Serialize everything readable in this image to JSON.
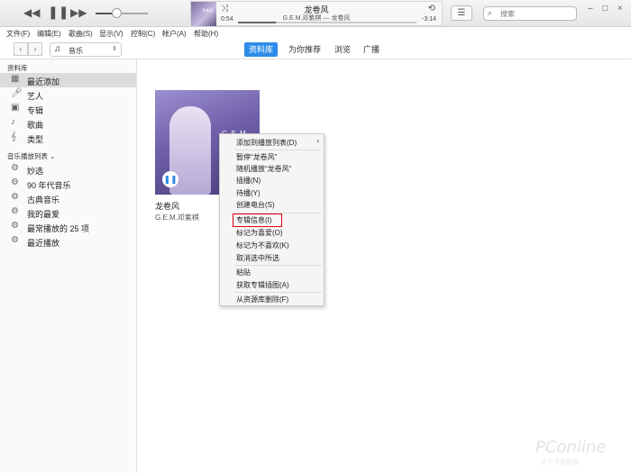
{
  "player": {
    "song_title": "龙卷风",
    "song_subtitle": "G.E.M.邓紫棋 — 龙卷风",
    "elapsed": "0:54",
    "remaining": "-3:14",
    "progress": 0.21,
    "volume": 0.4,
    "artwork_text": "龙卷风",
    "icons": [
      "rewind-icon",
      "pause-icon",
      "fast-forward-icon",
      "shuffle-icon",
      "repeat-icon",
      "list-icon",
      "search-icon"
    ]
  },
  "search": {
    "placeholder": "搜索"
  },
  "menubar": [
    "文件(F)",
    "编辑(E)",
    "歌曲(S)",
    "显示(V)",
    "控制(C)",
    "帐户(A)",
    "帮助(H)"
  ],
  "toolbar": {
    "media_type": "音乐",
    "tabs": [
      "资料库",
      "为你推荐",
      "浏览",
      "广播"
    ],
    "active_tab": "资料库"
  },
  "sidebar": {
    "library_header": "资料库",
    "library_items": [
      "最近添加",
      "艺人",
      "专辑",
      "歌曲",
      "类型"
    ],
    "selected_item": "最近添加",
    "playlists_header": "音乐播放列表 ⌄",
    "playlist_items": [
      "妙选",
      "90 年代音乐",
      "古典音乐",
      "我的最爱",
      "最常播放的 25 项",
      "最近播放"
    ]
  },
  "album": {
    "title": "龙卷风",
    "artist": "G.E.M.邓紫棋",
    "cover_logo": "G.E.M"
  },
  "context_menu": {
    "items": [
      "添加到播放列表(D)",
      "暂停“龙卷风”",
      "随机播放“龙卷风”",
      "插播(N)",
      "待播(Y)",
      "创建电台(S)",
      "专辑信息(I)",
      "标记为喜爱(O)",
      "标记为不喜欢(K)",
      "取消选中所选",
      "粘贴",
      "获取专辑插图(A)",
      "从资源库删除(F)"
    ],
    "submenu_arrow": "›",
    "highlighted_item": "专辑信息(I)",
    "highlight_color": "#e60012"
  },
  "watermark": {
    "brand": "PConline",
    "sub": "太平洋电脑网"
  },
  "colors": {
    "accent": "#2d8ce8",
    "highlight": "#e60012"
  }
}
